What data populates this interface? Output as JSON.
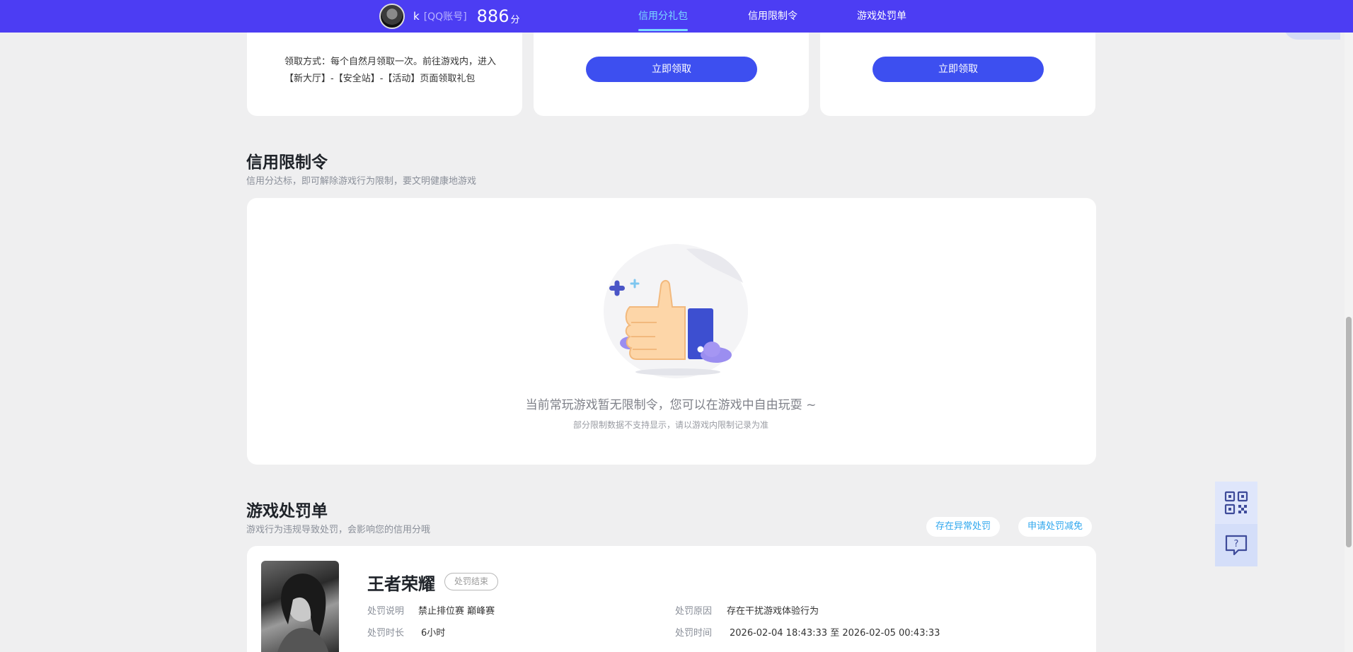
{
  "header": {
    "username": "k",
    "account_type": "[QQ账号]",
    "score": "886",
    "score_unit": "分",
    "tabs": [
      {
        "label": "信用分礼包",
        "active": true
      },
      {
        "label": "信用限制令",
        "active": false
      },
      {
        "label": "游戏处罚单",
        "active": false
      }
    ]
  },
  "gift": {
    "claim_text": "领取方式：每个自然月领取一次。前往游戏内，进入【新大厅】-【安全站】-【活动】页面领取礼包",
    "claim_button_label": "立即领取"
  },
  "restriction": {
    "title": "信用限制令",
    "subtitle": "信用分达标，即可解除游戏行为限制，要文明健康地游戏",
    "empty_message": "当前常玩游戏暂无限制令，您可以在游戏中自由玩耍 ~",
    "empty_tip": "部分限制数据不支持显示，请以游戏内限制记录为准"
  },
  "punishment": {
    "title": "游戏处罚单",
    "subtitle": "游戏行为违规导致处罚，会影响您的信用分哦",
    "report_abnormal_label": "存在异常处罚",
    "apply_reduction_label": "申请处罚减免",
    "record": {
      "game": "王者荣耀",
      "status": "处罚结束",
      "desc_label": "处罚说明",
      "desc_value": "禁止排位赛 巅峰赛",
      "reason_label": "处罚原因",
      "reason_value": "存在干扰游戏体验行为",
      "duration_label": "处罚时长",
      "duration_value": "6小时",
      "time_label": "处罚时间",
      "time_value": "2026-02-04 18:43:33 至 2026-02-05 00:43:33"
    }
  },
  "colors": {
    "nav_bg": "#4c3df3",
    "active_tab": "#7ad9ff",
    "button": "#3d4ff0",
    "link": "#2fa7ee"
  },
  "icons": [
    "qr-code-icon",
    "help-chat-icon",
    "thumbs-up-illustration"
  ]
}
